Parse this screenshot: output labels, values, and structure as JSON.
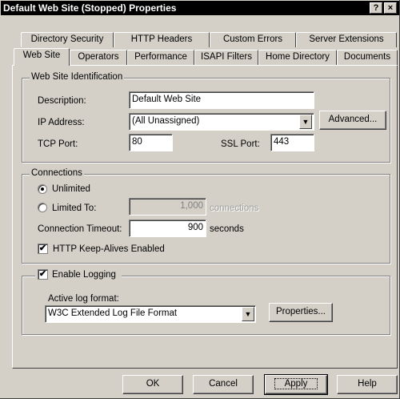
{
  "window": {
    "title": "Default Web Site (Stopped) Properties",
    "help_btn": "?",
    "close_btn": "×"
  },
  "tabs": {
    "row1": [
      "Directory Security",
      "HTTP Headers",
      "Custom Errors",
      "Server Extensions"
    ],
    "row2": [
      "Web Site",
      "Operators",
      "Performance",
      "ISAPI Filters",
      "Home Directory",
      "Documents"
    ],
    "active": "Web Site"
  },
  "identification": {
    "group_label": "Web Site Identification",
    "description_label": "Description:",
    "description_value": "Default Web Site",
    "ip_label": "IP Address:",
    "ip_value": "(All Unassigned)",
    "advanced_button": "Advanced...",
    "tcp_label": "TCP Port:",
    "tcp_value": "80",
    "ssl_label": "SSL Port:",
    "ssl_value": "443"
  },
  "connections": {
    "group_label": "Connections",
    "unlimited_label": "Unlimited",
    "limited_label": "Limited To:",
    "limited_value": "1,000",
    "limited_unit": "connections",
    "timeout_label": "Connection Timeout:",
    "timeout_value": "900",
    "timeout_unit": "seconds",
    "keepalive_label": "HTTP Keep-Alives Enabled",
    "unlimited_selected": true,
    "keepalive_checked": true
  },
  "logging": {
    "enable_label": "Enable Logging",
    "enabled": true,
    "format_label": "Active log format:",
    "format_value": "W3C Extended Log File Format",
    "properties_button": "Properties..."
  },
  "footer": {
    "ok": "OK",
    "cancel": "Cancel",
    "apply": "Apply",
    "help": "Help"
  },
  "icons": {
    "check": "✔",
    "dropdown": "▼"
  }
}
